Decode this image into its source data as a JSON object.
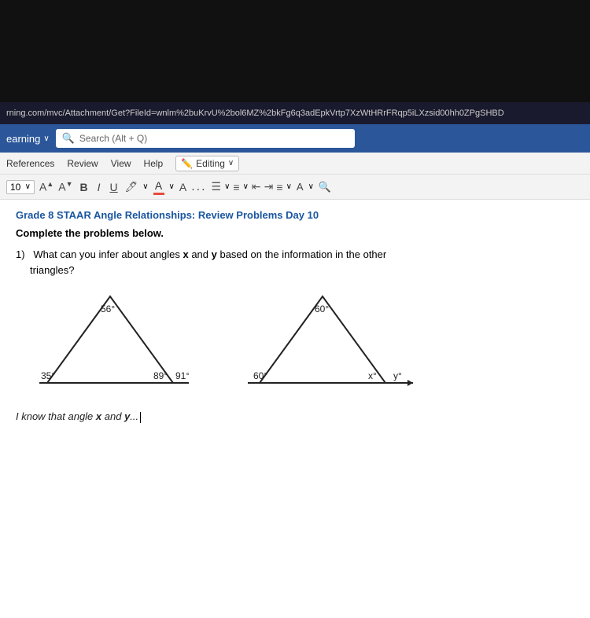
{
  "url": {
    "text": "rning.com/mvc/Attachment/Get?FileId=wnlm%2buKrvU%2bol6MZ%2bkFg6q3adEpkVrtp7XzWtHRrFRqp5iLXzsid00hh0ZPgSHBD"
  },
  "toolbar": {
    "learning_label": "earning",
    "search_placeholder": "Search (Alt + Q)",
    "menu": {
      "references": "References",
      "review": "Review",
      "view": "View",
      "help": "Help",
      "editing": "Editing"
    },
    "font_size": "10",
    "format_buttons": {
      "bold": "B",
      "italic": "I",
      "underline": "U",
      "more": "..."
    }
  },
  "document": {
    "title": "Grade 8 STAAR Angle Relationships: Review Problems Day 10",
    "subtitle": "Complete the problems below.",
    "problem1": {
      "number": "1)",
      "text": "What can you infer about angles x and y based on the information in the other triangles?",
      "triangle1": {
        "top_angle": "56°",
        "bottom_left": "35°",
        "bottom_right1": "89°",
        "bottom_right2": "91°"
      },
      "triangle2": {
        "top_angle": "60°",
        "bottom_left": "60°",
        "bottom_right1": "x°",
        "bottom_right2": "y°"
      },
      "answer_prefix": "I know that angle x and y..."
    }
  }
}
